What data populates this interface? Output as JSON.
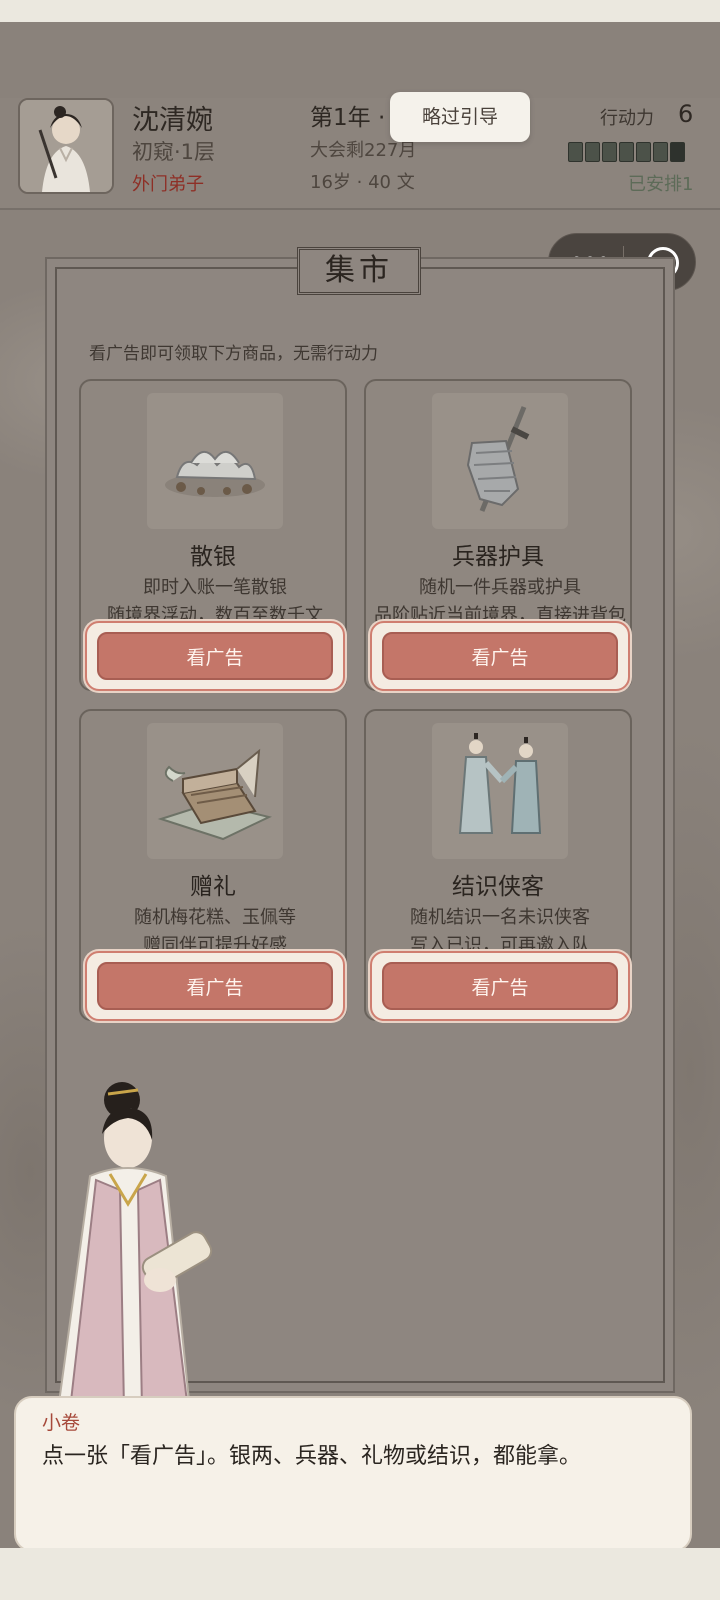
{
  "header": {
    "name": "沈清婉",
    "realm": "初窥·1层",
    "sect": "外门弟子",
    "year": "第1年 ·",
    "meet": "大会剩227月",
    "age_cash": "16岁 · 40 文",
    "skip_guide": "略过引导",
    "action_label": "行动力",
    "action_value": "6",
    "scheduled": "已安排1"
  },
  "market": {
    "title": "集市",
    "hint": "看广告即可领取下方商品，无需行动力",
    "cards": [
      {
        "title": "散银",
        "desc1": "即时入账一笔散银",
        "desc2": "随境界浮动，数百至数千文",
        "button": "看广告",
        "icon": "silver-ingots-icon"
      },
      {
        "title": "兵器护具",
        "desc1": "随机一件兵器或护具",
        "desc2": "品阶贴近当前境界，直接进背包",
        "button": "看广告",
        "icon": "sword-armor-icon"
      },
      {
        "title": "赠礼",
        "desc1": "随机梅花糕、玉佩等",
        "desc2": "赠同伴可提升好感",
        "button": "看广告",
        "icon": "gift-box-icon"
      },
      {
        "title": "结识侠客",
        "desc1": "随机结识一名未识侠客",
        "desc2": "写入已识，可再邀入队",
        "button": "看广告",
        "icon": "two-swordsmen-icon"
      }
    ]
  },
  "dialog": {
    "speaker": "小卷",
    "line": "点一张「看广告」。银两、兵器、礼物或结识，都能拿。"
  },
  "colors": {
    "accent_button": "#c47669",
    "sect_red": "#8e2f26",
    "panel": "#8e8680"
  }
}
